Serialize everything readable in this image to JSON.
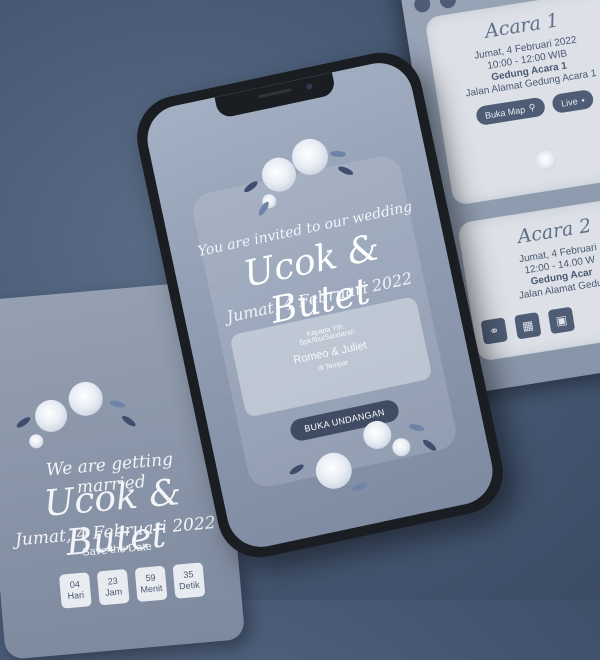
{
  "right_card": {
    "event1": {
      "title": "Acara 1",
      "day": "Jumat, 4 Februari 2022",
      "time": "10:00 - 12:00 WIB",
      "venue": "Gedung Acara 1",
      "address": "Jalan Alamat Gedung Acara 1",
      "map_button": "Buka Map",
      "live_button": "Live"
    },
    "event2": {
      "title": "Acara 2",
      "day": "Jumat, 4 Februari",
      "time": "12:00 - 14.00 W",
      "venue": "Gedung Acar",
      "address": "Jalan Alamat Gedun"
    }
  },
  "left_card": {
    "tagline": "We are getting married",
    "names": "Ucok & Butet",
    "date": "Jumat, 4 Februari 2022",
    "save_the_date": "- Save the Date -",
    "countdown": [
      {
        "value": "04",
        "unit": "Hari"
      },
      {
        "value": "23",
        "unit": "Jam"
      },
      {
        "value": "59",
        "unit": "Menit"
      },
      {
        "value": "35",
        "unit": "Detik"
      }
    ]
  },
  "phone": {
    "invited": "You are invited to our wedding",
    "names": "Ucok & Butet",
    "date": "Jumat, 4 Februari 2022",
    "guest_label": "Kepada Yth.",
    "guest_sub": "Bpk/Ibu/Saudara/i",
    "guest_name": "Romeo & Juliet",
    "guest_place": "di Tempat",
    "open_button": "BUKA UNDANGAN"
  },
  "colors": {
    "background": "#465873",
    "button": "#3f4c63",
    "card": "#dde1e7"
  }
}
